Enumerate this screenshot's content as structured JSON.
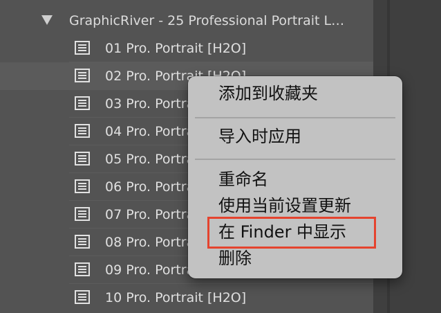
{
  "tree": {
    "folder": {
      "label": "GraphicRiver - 25 Professional Portrait L…",
      "expanded": true
    },
    "presets": [
      {
        "label": "01 Pro. Portrait [H2O]"
      },
      {
        "label": "02 Pro. Portrait [H2O]"
      },
      {
        "label": "03 Pro. Portrait [H2O]"
      },
      {
        "label": "04 Pro. Portrait [H2O]"
      },
      {
        "label": "05 Pro. Portrait [H2O]"
      },
      {
        "label": "06 Pro. Portrait [H2O]"
      },
      {
        "label": "07 Pro. Portrait [H2O]"
      },
      {
        "label": "08 Pro. Portrait [H2O]"
      },
      {
        "label": "09 Pro. Portrait [H2O]"
      },
      {
        "label": "10 Pro. Portrait [H2O]"
      }
    ]
  },
  "context_menu": {
    "items": [
      {
        "label": "添加到收藏夹"
      },
      {
        "label": "导入时应用"
      },
      {
        "label": "重命名"
      },
      {
        "label": "使用当前设置更新"
      },
      {
        "label": "在 Finder 中显示"
      },
      {
        "label": "删除"
      }
    ],
    "highlight_color": "#e5432e"
  },
  "icons": {
    "preset": "preset-list-icon",
    "disclosure": "disclosure-triangle-icon"
  }
}
